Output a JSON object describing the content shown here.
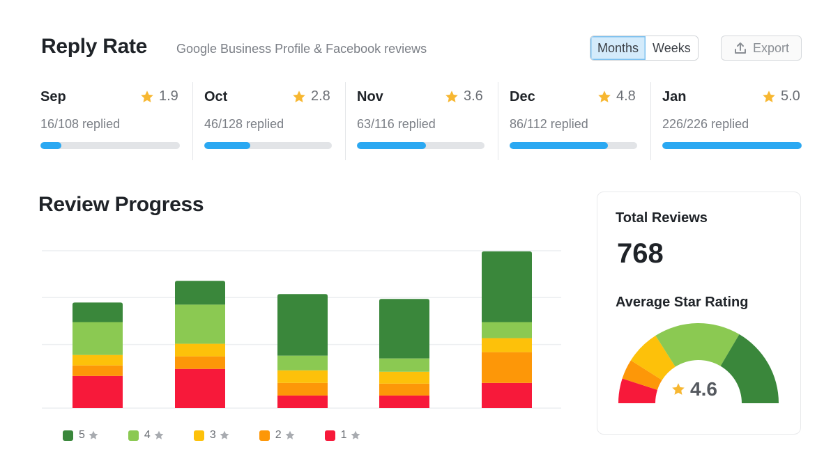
{
  "header": {
    "title": "Reply Rate",
    "subtitle": "Google Business Profile & Facebook reviews",
    "toggle": {
      "options": [
        "Months",
        "Weeks"
      ],
      "selected": "Months"
    },
    "export_label": "Export"
  },
  "months": [
    {
      "name": "Sep",
      "rating": "1.9",
      "replied_text": "16/108 replied",
      "replied": 16,
      "total": 108
    },
    {
      "name": "Oct",
      "rating": "2.8",
      "replied_text": "46/128 replied",
      "replied": 46,
      "total": 128
    },
    {
      "name": "Nov",
      "rating": "3.6",
      "replied_text": "63/116 replied",
      "replied": 63,
      "total": 116
    },
    {
      "name": "Dec",
      "rating": "4.8",
      "replied_text": "86/112 replied",
      "replied": 86,
      "total": 112
    },
    {
      "name": "Jan",
      "rating": "5.0",
      "replied_text": "226/226 replied",
      "replied": 226,
      "total": 226
    }
  ],
  "review_progress": {
    "title": "Review Progress"
  },
  "colors": {
    "accent": "#2aa8f2",
    "track": "#e2e4e7",
    "star": "#f7b731",
    "star_gray": "#a8abb0",
    "s5": "#3a873b",
    "s4": "#8bc952",
    "s3": "#fdc10a",
    "s2": "#fd9708",
    "s1": "#f7193a"
  },
  "chart_data": {
    "type": "bar",
    "stacked": true,
    "title": "Review Progress",
    "categories": [
      "Sep",
      "Oct",
      "Nov",
      "Dec",
      "Jan"
    ],
    "series": [
      {
        "name": "1 star",
        "key": "s1",
        "values": [
          46,
          56,
          18,
          18,
          36
        ]
      },
      {
        "name": "2 star",
        "key": "s2",
        "values": [
          15,
          18,
          18,
          17,
          44
        ]
      },
      {
        "name": "3 star",
        "key": "s3",
        "values": [
          15,
          18,
          18,
          17,
          20
        ]
      },
      {
        "name": "4 star",
        "key": "s4",
        "values": [
          47,
          56,
          21,
          19,
          23
        ]
      },
      {
        "name": "5 star",
        "key": "s5",
        "values": [
          28,
          34,
          88,
          85,
          101
        ]
      }
    ],
    "ylim": [
      0,
      225
    ],
    "gridlines": [
      91,
      158,
      225
    ],
    "xlabel": "",
    "ylabel": "",
    "grid": true,
    "legend": {
      "placement": "bottom-left",
      "entries": [
        {
          "label": "5",
          "key": "s5"
        },
        {
          "label": "4",
          "key": "s4"
        },
        {
          "label": "3",
          "key": "s3"
        },
        {
          "label": "2",
          "key": "s2"
        },
        {
          "label": "1",
          "key": "s1"
        }
      ]
    }
  },
  "summary": {
    "total_reviews_label": "Total Reviews",
    "total_reviews": "768",
    "avg_rating_label": "Average Star Rating",
    "avg_rating": "4.6",
    "gauge_segments": [
      {
        "key": "s1",
        "fraction": 0.1
      },
      {
        "key": "s2",
        "fraction": 0.08
      },
      {
        "key": "s3",
        "fraction": 0.14
      },
      {
        "key": "s4",
        "fraction": 0.35
      },
      {
        "key": "s5",
        "fraction": 0.33
      }
    ]
  }
}
